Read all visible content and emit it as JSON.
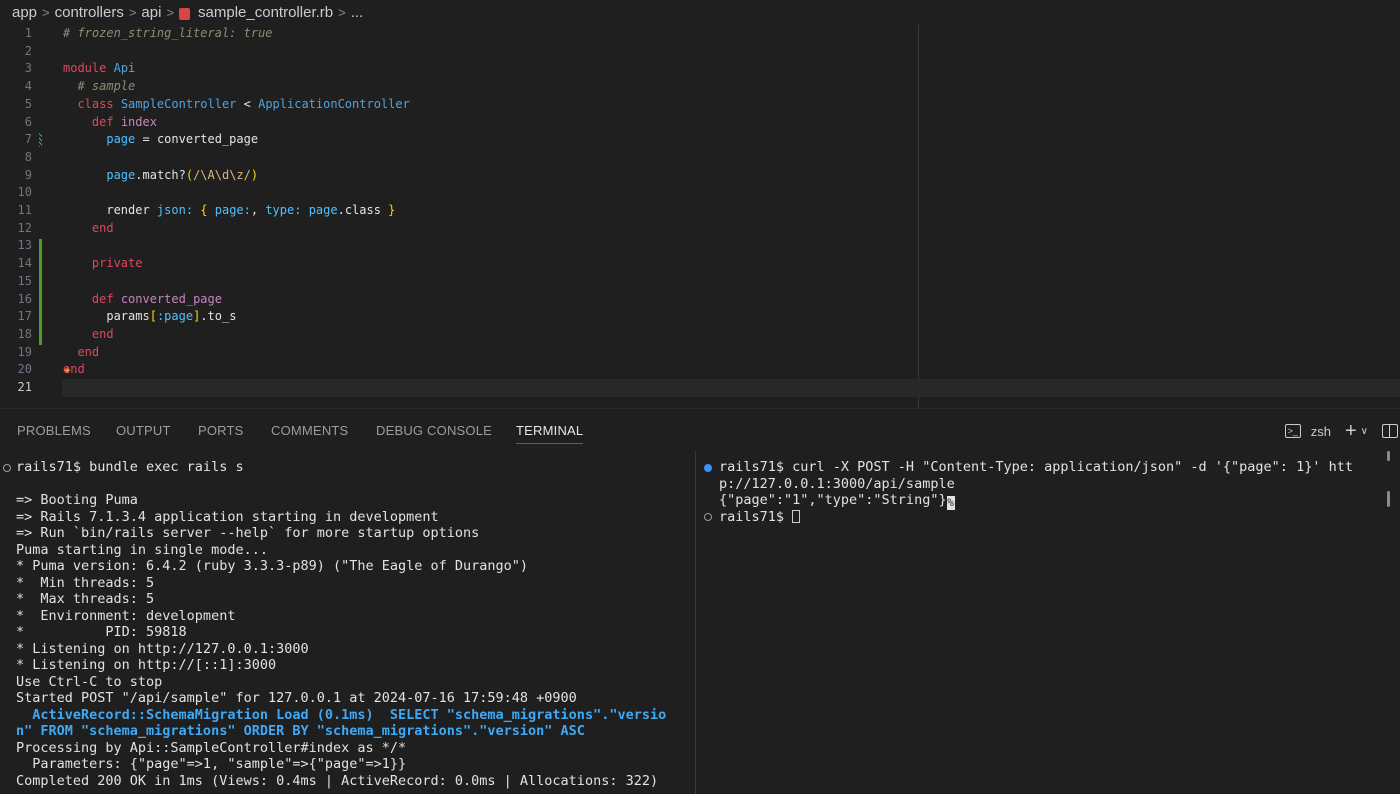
{
  "breadcrumb": {
    "items": [
      "app",
      "controllers",
      "api",
      "sample_controller.rb",
      "..."
    ],
    "separator": ">"
  },
  "editor": {
    "current_line": 21,
    "lines": [
      {
        "n": "1",
        "tokens": [
          [
            "c-com",
            "# frozen_string_literal: true"
          ]
        ]
      },
      {
        "n": "2",
        "tokens": []
      },
      {
        "n": "3",
        "tokens": [
          [
            "c-kw",
            "module"
          ],
          [
            "c-plain",
            " "
          ],
          [
            "c-mod",
            "Api"
          ]
        ]
      },
      {
        "n": "4",
        "tokens": [
          [
            "c-plain",
            "  "
          ],
          [
            "c-com",
            "# sample"
          ]
        ]
      },
      {
        "n": "5",
        "tokens": [
          [
            "c-plain",
            "  "
          ],
          [
            "c-kw",
            "class"
          ],
          [
            "c-plain",
            " "
          ],
          [
            "c-mod",
            "SampleController"
          ],
          [
            "c-plain",
            " < "
          ],
          [
            "c-mod",
            "ApplicationController"
          ]
        ]
      },
      {
        "n": "6",
        "tokens": [
          [
            "c-plain",
            "    "
          ],
          [
            "c-def",
            "def"
          ],
          [
            "c-plain",
            " "
          ],
          [
            "c-fn",
            "index"
          ]
        ]
      },
      {
        "n": "7",
        "tokens": [
          [
            "c-plain",
            "      "
          ],
          [
            "c-var",
            "page"
          ],
          [
            "c-plain",
            " = converted_page"
          ]
        ]
      },
      {
        "n": "8",
        "tokens": []
      },
      {
        "n": "9",
        "tokens": [
          [
            "c-plain",
            "      "
          ],
          [
            "c-var",
            "page"
          ],
          [
            "c-plain",
            ".match?"
          ],
          [
            "c-br",
            "("
          ],
          [
            "c-reg",
            "/\\A\\d\\z/"
          ],
          [
            "c-br",
            ")"
          ]
        ]
      },
      {
        "n": "10",
        "tokens": []
      },
      {
        "n": "11",
        "tokens": [
          [
            "c-plain",
            "      render "
          ],
          [
            "c-sym",
            "json:"
          ],
          [
            "c-plain",
            " "
          ],
          [
            "c-br",
            "{"
          ],
          [
            "c-plain",
            " "
          ],
          [
            "c-sym",
            "page:"
          ],
          [
            "c-plain",
            ", "
          ],
          [
            "c-sym",
            "type:"
          ],
          [
            "c-plain",
            " "
          ],
          [
            "c-var",
            "page"
          ],
          [
            "c-plain",
            ".class "
          ],
          [
            "c-br",
            "}"
          ]
        ]
      },
      {
        "n": "12",
        "tokens": [
          [
            "c-plain",
            "    "
          ],
          [
            "c-def",
            "end"
          ]
        ]
      },
      {
        "n": "13",
        "tokens": []
      },
      {
        "n": "14",
        "tokens": [
          [
            "c-plain",
            "    "
          ],
          [
            "c-kw",
            "private"
          ]
        ]
      },
      {
        "n": "15",
        "tokens": []
      },
      {
        "n": "16",
        "tokens": [
          [
            "c-plain",
            "    "
          ],
          [
            "c-def",
            "def"
          ],
          [
            "c-plain",
            " "
          ],
          [
            "c-fn",
            "converted_page"
          ]
        ]
      },
      {
        "n": "17",
        "tokens": [
          [
            "c-plain",
            "      params"
          ],
          [
            "c-br",
            "["
          ],
          [
            "c-sym",
            ":page"
          ],
          [
            "c-br",
            "]"
          ],
          [
            "c-plain",
            ".to_s"
          ]
        ]
      },
      {
        "n": "18",
        "tokens": [
          [
            "c-plain",
            "    "
          ],
          [
            "c-def",
            "end"
          ]
        ]
      },
      {
        "n": "19",
        "tokens": [
          [
            "c-plain",
            "  "
          ],
          [
            "c-def",
            "end"
          ]
        ]
      },
      {
        "n": "20",
        "tokens": [
          [
            "c-def",
            "end"
          ]
        ]
      },
      {
        "n": "21",
        "tokens": []
      }
    ]
  },
  "panel": {
    "tabs": [
      "PROBLEMS",
      "OUTPUT",
      "PORTS",
      "COMMENTS",
      "DEBUG CONSOLE",
      "TERMINAL"
    ],
    "active_tab": "TERMINAL",
    "shell_label": "zsh",
    "plus_label": "+",
    "chevron_label": "∨"
  },
  "terminal_left": {
    "lines": [
      "rails71$ bundle exec rails s",
      "",
      "=> Booting Puma",
      "=> Rails 7.1.3.4 application starting in development",
      "=> Run `bin/rails server --help` for more startup options",
      "Puma starting in single mode...",
      "* Puma version: 6.4.2 (ruby 3.3.3-p89) (\"The Eagle of Durango\")",
      "*  Min threads: 5",
      "*  Max threads: 5",
      "*  Environment: development",
      "*          PID: 59818",
      "* Listening on http://127.0.0.1:3000",
      "* Listening on http://[::1]:3000",
      "Use Ctrl-C to stop",
      "Started POST \"/api/sample\" for 127.0.0.1 at 2024-07-16 17:59:48 +0900",
      "  ActiveRecord::SchemaMigration Load (0.1ms)  SELECT \"schema_migrations\".\"versio",
      "n\" FROM \"schema_migrations\" ORDER BY \"schema_migrations\".\"version\" ASC",
      "Processing by Api::SampleController#index as */*",
      "  Parameters: {\"page\"=>1, \"sample\"=>{\"page\"=>1}}",
      "Completed 200 OK in 1ms (Views: 0.4ms | ActiveRecord: 0.0ms | Allocations: 322)"
    ]
  },
  "terminal_right": {
    "lines": [
      "rails71$ curl -X POST -H \"Content-Type: application/json\" -d '{\"page\": 1}' htt",
      "p://127.0.0.1:3000/api/sample",
      "{\"page\":\"1\",\"type\":\"String\"}",
      "rails71$ "
    ],
    "end_marker": "%"
  }
}
